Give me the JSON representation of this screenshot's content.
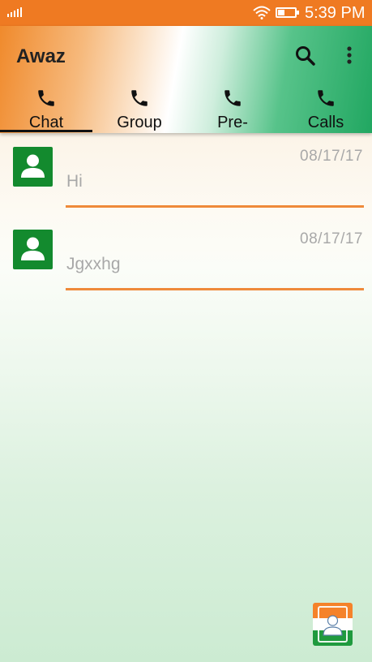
{
  "status_bar": {
    "time": "5:39 PM",
    "icons": [
      "signal-icon",
      "wifi-icon",
      "battery-icon"
    ]
  },
  "app_bar": {
    "title": "Awaz",
    "actions": [
      "search-icon",
      "more-vert-icon"
    ]
  },
  "tabs": [
    {
      "label": "Chat",
      "icon": "phone-icon",
      "selected": true
    },
    {
      "label": "Group",
      "icon": "phone-icon",
      "selected": false
    },
    {
      "label": "Pre-",
      "icon": "phone-icon",
      "selected": false
    },
    {
      "label": "Calls",
      "icon": "phone-icon",
      "selected": false
    }
  ],
  "chats": [
    {
      "name": "Hi",
      "date": "08/17/17"
    },
    {
      "name": "Jgxxhg",
      "date": "08/17/17"
    }
  ],
  "colors": {
    "status_bar": "#ef7a22",
    "avatar": "#138a2e",
    "divider": "#ef8a3a",
    "flag_saffron": "#f5822a",
    "flag_green": "#1f9a3e"
  }
}
